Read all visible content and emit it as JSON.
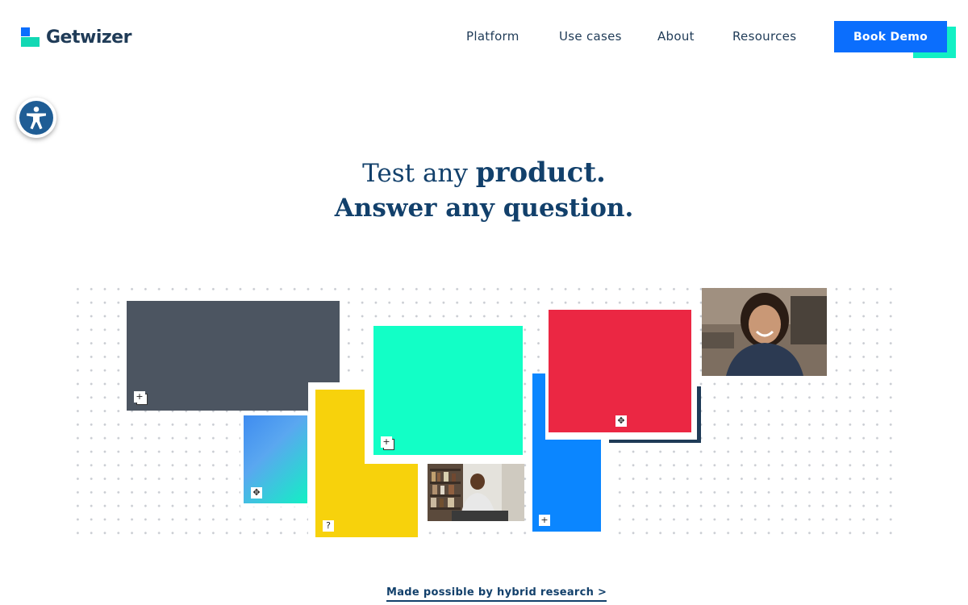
{
  "brand": {
    "name": "Getwizer"
  },
  "nav": {
    "items": [
      {
        "label": "Platform"
      },
      {
        "label": "Use cases"
      },
      {
        "label": "About"
      },
      {
        "label": "Resources"
      }
    ],
    "cta_label": "Book Demo"
  },
  "accessibility": {
    "icon": "accessibility-icon"
  },
  "hero": {
    "line1_prefix": "Test any ",
    "line1_emphasis": "product.",
    "line2": "Answer any question."
  },
  "collage": {
    "colors": {
      "slate": "#4c5561",
      "aqua": "#12ffc6",
      "red": "#eb2743",
      "blue": "#0b86ff",
      "yellow": "#f7d20c",
      "navy": "#1f3b57"
    },
    "badges": [
      "plus",
      "plus",
      "move",
      "move",
      "question",
      "plus"
    ]
  },
  "footer_cta": {
    "label": "Made possible by hybrid research >"
  }
}
